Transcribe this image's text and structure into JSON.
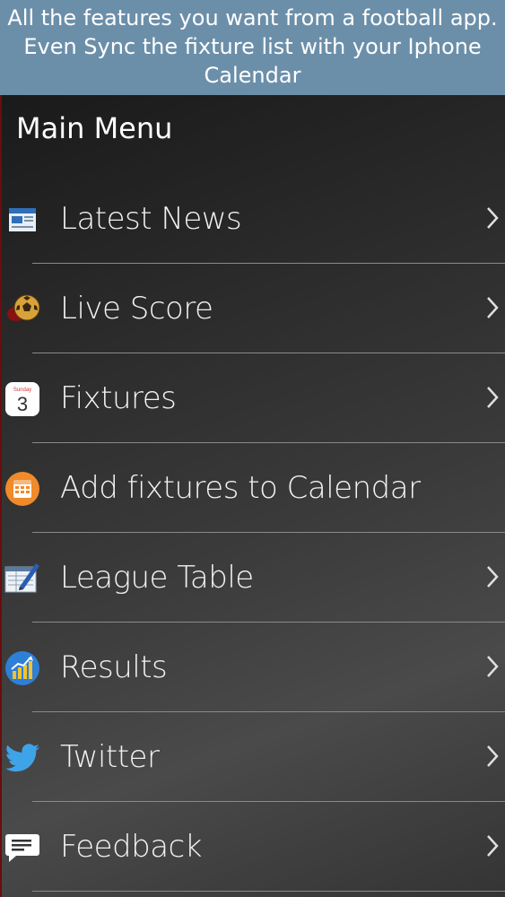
{
  "banner": {
    "line1": "All the features you want from a football app.",
    "line2": "Even Sync the fixture list with your Iphone",
    "line3": "Calendar"
  },
  "header": {
    "title": "Main Menu"
  },
  "calendar_icon": {
    "day_name": "Sunday",
    "day_number": "3"
  },
  "menu": {
    "items": [
      {
        "label": "Latest News",
        "icon": "newspaper-icon",
        "has_chevron": true
      },
      {
        "label": "Live Score",
        "icon": "football-icon",
        "has_chevron": true
      },
      {
        "label": "Fixtures",
        "icon": "calendar-icon",
        "has_chevron": true
      },
      {
        "label": "Add fixtures to Calendar",
        "icon": "calendar-add-icon",
        "has_chevron": false
      },
      {
        "label": "League Table",
        "icon": "notepad-icon",
        "has_chevron": true
      },
      {
        "label": "Results",
        "icon": "chart-icon",
        "has_chevron": true
      },
      {
        "label": "Twitter",
        "icon": "twitter-icon",
        "has_chevron": true
      },
      {
        "label": "Feedback",
        "icon": "feedback-icon",
        "has_chevron": true
      }
    ]
  },
  "colors": {
    "banner_bg": "#6c8fa9",
    "text": "#ffffff",
    "divider": "#8a8a8a"
  }
}
